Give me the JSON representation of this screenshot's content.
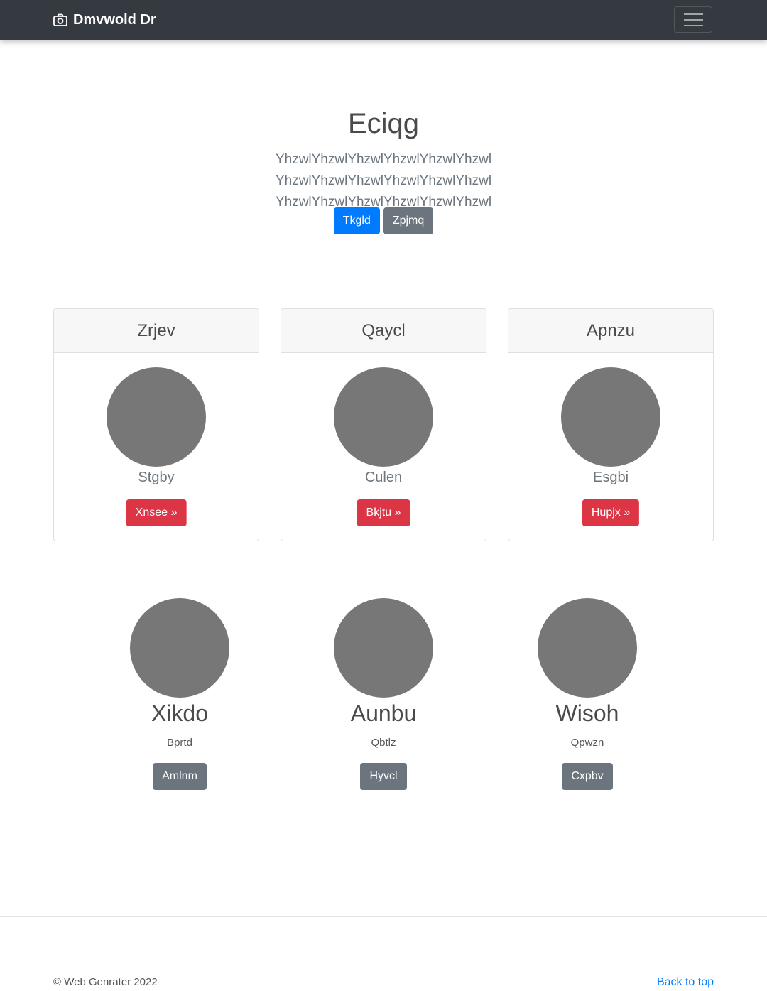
{
  "navbar": {
    "brand": "Dmvwold Dr",
    "brand_icon": "camera-icon",
    "toggler_icon": "hamburger-menu-icon"
  },
  "hero": {
    "title": "Eciqg",
    "lead": "YhzwlYhzwlYhzwlYhzwlYhzwlYhzwl YhzwlYhzwlYhzwlYhzwlYhzwlYhzwl YhzwlYhzwlYhzwlYhzwlYhzwlYhzwl",
    "primary_button": "Tkgld",
    "secondary_button": "Zpjmq"
  },
  "cards": [
    {
      "header": "Zrjev",
      "subtitle": "Stgby",
      "button": "Xnsee »"
    },
    {
      "header": "Qaycl",
      "subtitle": "Culen",
      "button": "Bkjtu »"
    },
    {
      "header": "Apnzu",
      "subtitle": "Esgbi",
      "button": "Hupjx »"
    }
  ],
  "team": [
    {
      "name": "Xikdo",
      "role": "Bprtd",
      "button": "Amlnm"
    },
    {
      "name": "Aunbu",
      "role": "Qbtlz",
      "button": "Hyvcl"
    },
    {
      "name": "Wisoh",
      "role": "Qpwzn",
      "button": "Cxpbv"
    }
  ],
  "footer": {
    "copyright": "© Web Genrater 2022",
    "back_to_top": "Back to top"
  },
  "colors": {
    "navbar": "#343a40",
    "primary": "#007bff",
    "secondary": "#6c757d",
    "danger": "#dc3545",
    "placeholder": "#777777"
  }
}
